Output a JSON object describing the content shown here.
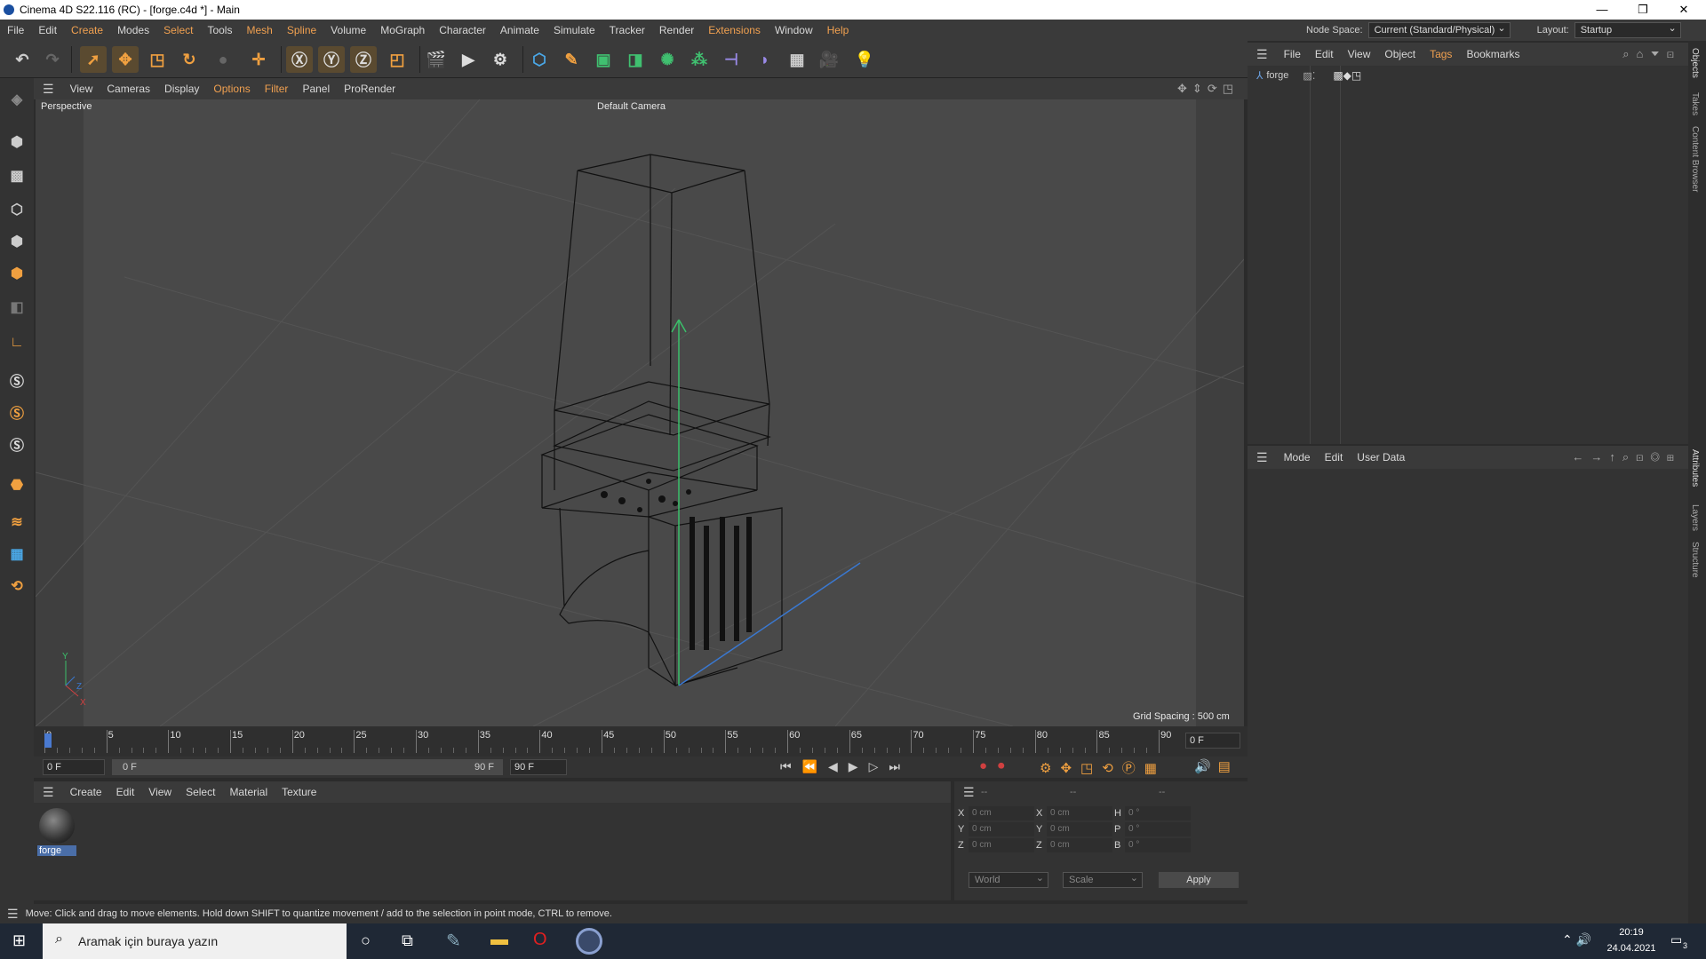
{
  "window": {
    "title": "Cinema 4D S22.116 (RC) - [forge.c4d *] - Main",
    "minimize": "—",
    "restore": "❐",
    "close": "✕"
  },
  "menu": [
    "File",
    "Edit",
    "Create",
    "Modes",
    "Select",
    "Tools",
    "Mesh",
    "Spline",
    "Volume",
    "MoGraph",
    "Character",
    "Animate",
    "Simulate",
    "Tracker",
    "Render",
    "Extensions",
    "Window",
    "Help"
  ],
  "node_space": {
    "label": "Node Space:",
    "value": "Current (Standard/Physical)"
  },
  "layout": {
    "label": "Layout:",
    "value": "Startup"
  },
  "viewport": {
    "menu": [
      "View",
      "Cameras",
      "Display",
      "Options",
      "Filter",
      "Panel",
      "ProRender"
    ],
    "name": "Perspective",
    "camera": "Default Camera",
    "grid_spacing": "Grid Spacing : 500 cm"
  },
  "timeline": {
    "ticks": [
      "0",
      "5",
      "10",
      "15",
      "20",
      "25",
      "30",
      "35",
      "40",
      "45",
      "50",
      "55",
      "60",
      "65",
      "70",
      "75",
      "80",
      "85",
      "90"
    ],
    "current_frame": "0 F",
    "start": "0 F",
    "range_start": "0 F",
    "range_end": "90 F",
    "end": "90 F"
  },
  "materials": {
    "menu": [
      "Create",
      "Edit",
      "View",
      "Select",
      "Material",
      "Texture"
    ],
    "item": "forge"
  },
  "coords": {
    "headers": [
      "--",
      "--",
      "--"
    ],
    "rows": [
      {
        "a": "X",
        "av": "0 cm",
        "b": "X",
        "bv": "0 cm",
        "c": "H",
        "cv": "0 °"
      },
      {
        "a": "Y",
        "av": "0 cm",
        "b": "Y",
        "bv": "0 cm",
        "c": "P",
        "cv": "0 °"
      },
      {
        "a": "Z",
        "av": "0 cm",
        "b": "Z",
        "bv": "0 cm",
        "c": "B",
        "cv": "0 °"
      }
    ],
    "mode1": "World",
    "mode2": "Scale",
    "apply": "Apply"
  },
  "objects": {
    "menu": [
      "File",
      "Edit",
      "View",
      "Object",
      "Tags",
      "Bookmarks"
    ],
    "item": "forge"
  },
  "attributes": {
    "menu": [
      "Mode",
      "Edit",
      "User Data"
    ]
  },
  "side_tabs": [
    "Objects",
    "Takes",
    "Content Browser",
    "Attributes",
    "Layers",
    "Structure"
  ],
  "status": "Move: Click and drag to move elements. Hold down SHIFT to quantize movement / add to the selection in point mode, CTRL to remove.",
  "taskbar": {
    "search_placeholder": "Aramak için buraya yazın",
    "time": "20:19",
    "date": "24.04.2021",
    "notifications": "3"
  },
  "axis": {
    "y": "Y",
    "z": "Z",
    "x": "X"
  }
}
